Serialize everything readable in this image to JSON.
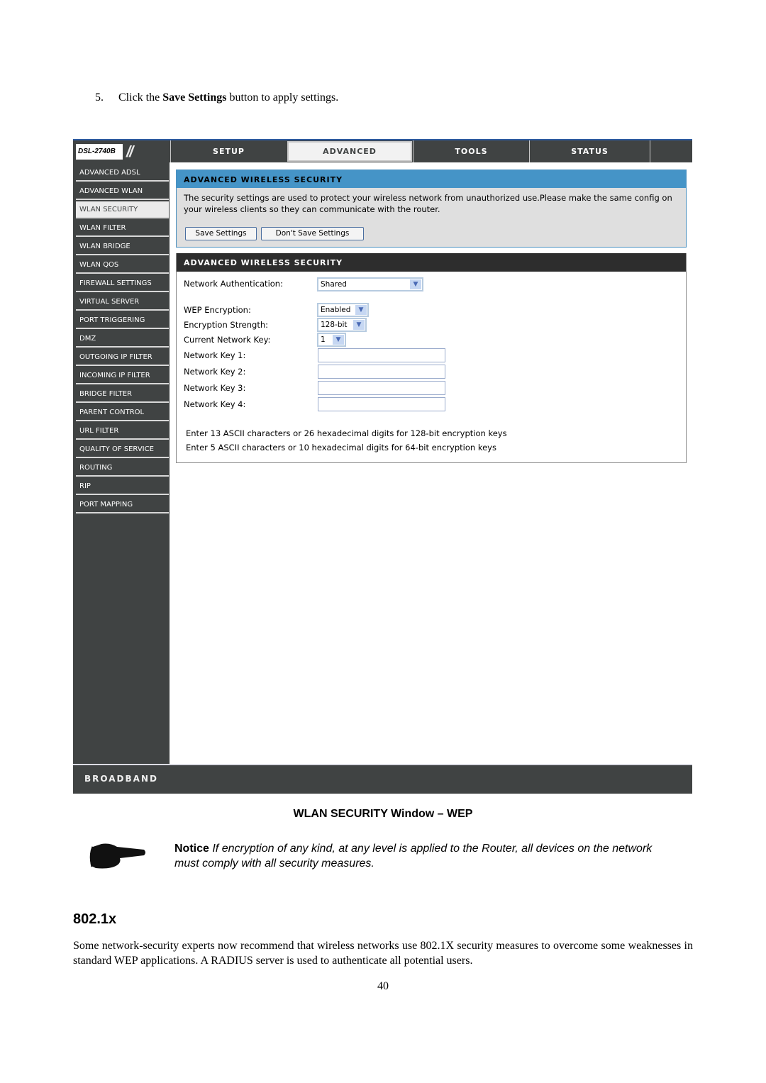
{
  "document": {
    "step_number": "5.",
    "step_prefix": "Click the ",
    "step_bold": "Save Settings",
    "step_suffix": " button to apply settings.",
    "figure_caption": "WLAN SECURITY Window – WEP",
    "notice_label": "Notice",
    "notice_text": " If encryption of any kind, at any level is applied to the Router, all devices on the network must comply with all security measures.",
    "section_heading": "802.1x",
    "section_paragraph": "Some network-security experts now recommend that wireless networks use 802.1X security measures to overcome some weaknesses in standard WEP applications. A RADIUS server is used to authenticate all potential users.",
    "page_number": "40",
    "notice_icon": "pointing-hand-icon"
  },
  "router": {
    "model": "DSL-2740B",
    "tabs": [
      {
        "label": "SETUP",
        "active": false
      },
      {
        "label": "ADVANCED",
        "active": true
      },
      {
        "label": "TOOLS",
        "active": false
      },
      {
        "label": "STATUS",
        "active": false
      }
    ],
    "sidebar": [
      {
        "label": "ADVANCED ADSL"
      },
      {
        "label": "ADVANCED WLAN"
      },
      {
        "label": "WLAN SECURITY",
        "active": true
      },
      {
        "label": "WLAN FILTER"
      },
      {
        "label": "WLAN BRIDGE"
      },
      {
        "label": "WLAN QOS"
      },
      {
        "label": "FIREWALL SETTINGS"
      },
      {
        "label": "VIRTUAL SERVER"
      },
      {
        "label": "PORT TRIGGERING"
      },
      {
        "label": "DMZ"
      },
      {
        "label": "OUTGOING IP FILTER"
      },
      {
        "label": "INCOMING IP FILTER"
      },
      {
        "label": "BRIDGE FILTER"
      },
      {
        "label": "PARENT CONTROL"
      },
      {
        "label": "URL FILTER"
      },
      {
        "label": "QUALITY OF SERVICE"
      },
      {
        "label": "ROUTING"
      },
      {
        "label": "RIP"
      },
      {
        "label": "PORT MAPPING"
      }
    ],
    "intro_box": {
      "title": "ADVANCED WIRELESS SECURITY",
      "description": "The security settings are used to protect your wireless network from unauthorized use.Please make the same config on your wireless clients so they can communicate with the router.",
      "save_button": "Save Settings",
      "dont_save_button": "Don't Save Settings"
    },
    "settings_box": {
      "title": "ADVANCED WIRELESS SECURITY",
      "network_auth_label": "Network Authentication:",
      "network_auth_value": "Shared",
      "wep_label": "WEP Encryption:",
      "wep_value": "Enabled",
      "strength_label": "Encryption Strength:",
      "strength_value": "128-bit",
      "current_key_label": "Current Network Key:",
      "current_key_value": "1",
      "keys": [
        {
          "label": "Network Key 1:",
          "value": ""
        },
        {
          "label": "Network Key 2:",
          "value": ""
        },
        {
          "label": "Network Key 3:",
          "value": ""
        },
        {
          "label": "Network Key 4:",
          "value": ""
        }
      ],
      "note_128": "Enter 13 ASCII characters or 26 hexadecimal digits for 128-bit encryption keys",
      "note_64": "Enter 5 ASCII characters or 10 hexadecimal digits for 64-bit encryption keys"
    },
    "footer_brand": "BROADBAND",
    "dropdown_arrow_icon": "chevron-down-icon"
  }
}
